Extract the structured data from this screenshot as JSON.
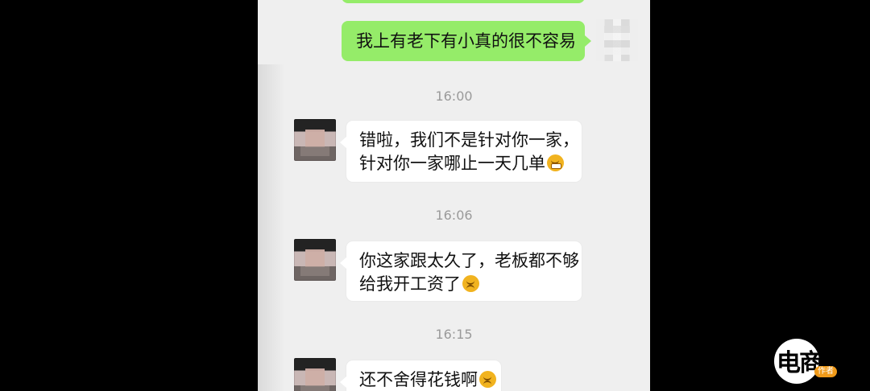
{
  "chat": {
    "self_message": "我上有老下有小真的很不容易",
    "messages": [
      {
        "time": "16:00",
        "lines": [
          "错啦，我们不是针对你一家，",
          "针对你一家哪止一天几单"
        ],
        "emoji": "grinning-face-icon"
      },
      {
        "time": "16:06",
        "lines": [
          "你这家跟太久了，老板都不够",
          "给我开工资了"
        ],
        "emoji": "sweating-face-icon"
      },
      {
        "time": "16:15",
        "lines": [
          "还不舍得花钱啊"
        ],
        "emoji": "sweating-face-icon"
      }
    ]
  },
  "watermark": {
    "brand": "电商报",
    "author": "作者"
  },
  "colors": {
    "background": "#000000",
    "chat_background": "#efefef",
    "self_bubble": "#95ec69",
    "other_bubble": "#ffffff",
    "timestamp": "#9a9a9a"
  }
}
